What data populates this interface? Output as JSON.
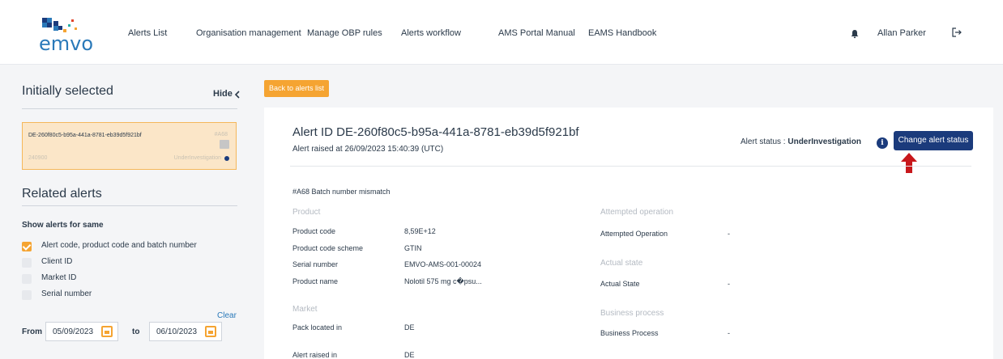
{
  "nav": {
    "logo_text": "emvo",
    "items": [
      {
        "label": "Alerts List"
      },
      {
        "label": "Organisation management"
      },
      {
        "label": "Manage OBP rules"
      },
      {
        "label": "Alerts workflow"
      },
      {
        "label": "AMS Portal Manual"
      },
      {
        "label": "EAMS Handbook"
      }
    ],
    "user_name": "Allan Parker",
    "icons": {
      "notifications": "bell-icon",
      "logout": "logout-icon"
    }
  },
  "left_panel": {
    "initially_selected_title": "Initially selected",
    "hide_label": "Hide",
    "selected_alert": {
      "id": "DE-260f80c5-b95a-441a-8781-eb39d5f921bf",
      "code": "#A68",
      "product": "240900",
      "status": "UnderInvestigation"
    },
    "related_title": "Related alerts",
    "show_same_label": "Show alerts for same",
    "filters": [
      {
        "label": "Alert code, product code and batch number",
        "checked": true
      },
      {
        "label": "Client ID",
        "checked": false
      },
      {
        "label": "Market ID",
        "checked": false
      },
      {
        "label": "Serial number",
        "checked": false
      }
    ],
    "clear_label": "Clear",
    "from_label": "From",
    "from_date": "05/09/2023",
    "to_label": "to",
    "to_date": "06/10/2023"
  },
  "main": {
    "back_button": "Back to alerts list",
    "alert_title": "Alert ID DE-260f80c5-b95a-441a-8781-eb39d5f921bf",
    "raised_at": "Alert raised at 26/09/2023 15:40:39 (UTC)",
    "status_label": "Alert status : ",
    "status_value": "UnderInvestigation",
    "change_status_button": "Change alert status",
    "rule": "#A68   Batch number mismatch",
    "product_section": "Product",
    "product_fields": [
      {
        "label": "Product code",
        "value": "8,59E+12"
      },
      {
        "label": "Product code scheme",
        "value": "GTIN"
      },
      {
        "label": "Serial number",
        "value": "EMVO-AMS-001-00024"
      },
      {
        "label": "Product name",
        "value": "Nolotil 575 mg c�psu..."
      }
    ],
    "market_section": "Market",
    "market_fields": [
      {
        "label": "Pack located in",
        "value": "DE"
      },
      {
        "label": "Alert raised in",
        "value": "DE"
      }
    ],
    "attempted_section": "Attempted operation",
    "attempted_label": "Attempted Operation",
    "attempted_value": "-",
    "actual_section": "Actual state",
    "actual_label": "Actual State",
    "actual_value": "-",
    "business_section": "Business process",
    "business_label": "Business Process",
    "business_value": "-"
  },
  "colors": {
    "accent_orange": "#f5a432",
    "primary_navy": "#1b3b7c",
    "arrow_red": "#c8171b",
    "card_highlight": "#fbe6c8"
  }
}
